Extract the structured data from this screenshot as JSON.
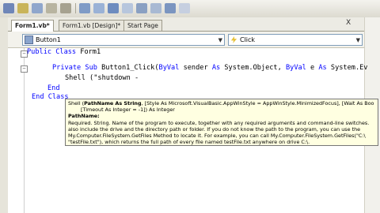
{
  "tabs": [
    {
      "label": "Form1.vb*",
      "active": true
    },
    {
      "label": "Form1.vb [Design]*",
      "active": false
    },
    {
      "label": "Start Page",
      "active": false
    }
  ],
  "tab_close": "X",
  "object_combo": {
    "value": "Button1"
  },
  "event_combo": {
    "value": "Click"
  },
  "code": {
    "line1_kw": "Public Class",
    "line1_name": " Form1",
    "line2_kw1": "Private Sub",
    "line2_mid": " Button1_Click(",
    "line2_kw2": "ByVal",
    "line2_mid2": " sender ",
    "line2_kw3": "As",
    "line2_mid3": " System.Object, ",
    "line2_kw4": "ByVal",
    "line2_mid4": " e ",
    "line2_kw5": "As",
    "line2_tail": " System.Ev",
    "line3": "Shell (\"shutdown -",
    "line4_kw": "End",
    "line5_kw": "End Class"
  },
  "tooltip": {
    "sig_a": "Shell (",
    "sig_bold": "PathName As String",
    "sig_b": ", [Style As Microsoft.VisualBasic.AppWinStyle = AppWinStyle.MinimizedFocus], [Wait As Boo",
    "sig_c": "[Timeout As Integer = -1]) As Integer",
    "param_name": "PathName:",
    "desc1": "Required. String. Name of the program to execute, together with any required arguments and command-line switches.",
    "desc2": "also include the drive and the directory path or folder. If you do not know the path to the program, you can use the",
    "desc3": "My.Computer.FileSystem.GetFiles Method to locate it. For example, you can call My.Computer.FileSystem.GetFiles(\"C:\\",
    "desc4": "\"testFile.txt\"), which returns the full path of every file named testFile.txt anywhere on drive C:\\."
  },
  "colors": {
    "keyword": "#0000ff",
    "tooltip_bg": "#ffffe1"
  }
}
